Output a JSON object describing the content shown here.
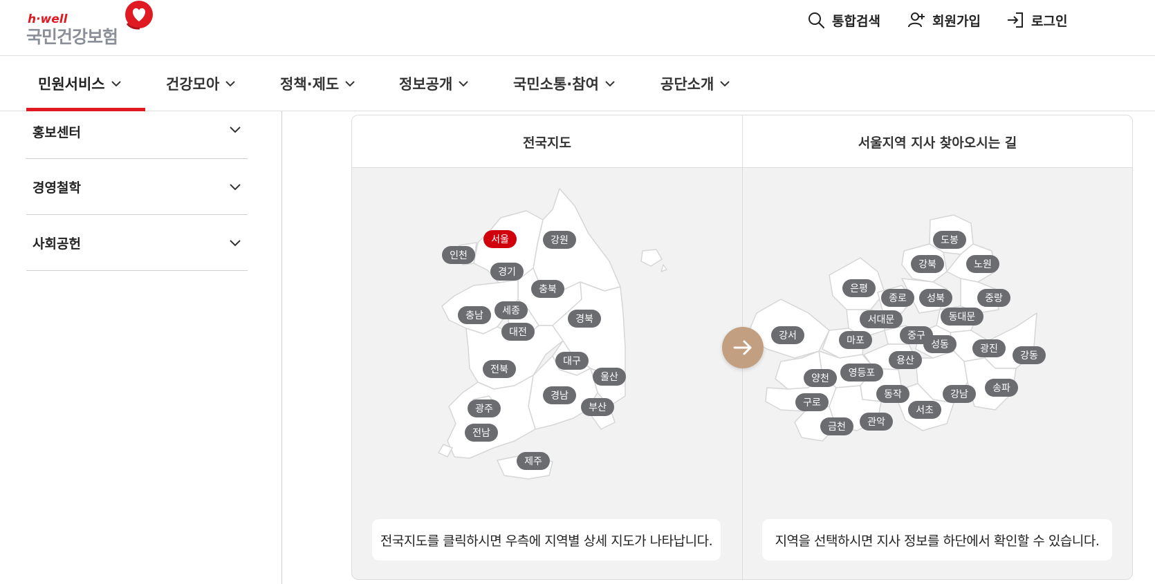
{
  "logo": {
    "sub": "h·well",
    "main": "국민건강보험"
  },
  "util": {
    "search": "통합검색",
    "join": "회원가입",
    "login": "로그인"
  },
  "gnb": [
    {
      "label": "민원서비스"
    },
    {
      "label": "건강모아"
    },
    {
      "label": "정책·제도"
    },
    {
      "label": "정보공개"
    },
    {
      "label": "국민소통·참여"
    },
    {
      "label": "공단소개"
    }
  ],
  "sidebar": [
    {
      "label": "홍보센터"
    },
    {
      "label": "경영철학"
    },
    {
      "label": "사회공헌"
    }
  ],
  "panel": {
    "left_title": "전국지도",
    "right_title": "서울지역 지사 찾아오시는 길",
    "left_caption": "전국지도를 클릭하시면 우측에 지역별 상세 지도가 나타납니다.",
    "right_caption": "지역을 선택하시면 지사 정보를 하단에서 확인할 수 있습니다."
  },
  "colors": {
    "accent": "#e01a22",
    "label": "#6b6c70",
    "selected": "#d0000c",
    "arrow": "#c29f81"
  },
  "national_regions": [
    {
      "name": "서울",
      "selected": true
    },
    {
      "name": "강원"
    },
    {
      "name": "인천"
    },
    {
      "name": "경기"
    },
    {
      "name": "충북"
    },
    {
      "name": "충남"
    },
    {
      "name": "세종"
    },
    {
      "name": "경북"
    },
    {
      "name": "대전"
    },
    {
      "name": "대구"
    },
    {
      "name": "전북"
    },
    {
      "name": "울산"
    },
    {
      "name": "경남"
    },
    {
      "name": "광주"
    },
    {
      "name": "부산"
    },
    {
      "name": "전남"
    },
    {
      "name": "제주"
    }
  ],
  "seoul_districts": [
    {
      "name": "도봉"
    },
    {
      "name": "강북"
    },
    {
      "name": "노원"
    },
    {
      "name": "은평"
    },
    {
      "name": "종로"
    },
    {
      "name": "성북"
    },
    {
      "name": "중랑"
    },
    {
      "name": "서대문"
    },
    {
      "name": "동대문"
    },
    {
      "name": "강서"
    },
    {
      "name": "중구"
    },
    {
      "name": "마포"
    },
    {
      "name": "성동"
    },
    {
      "name": "광진"
    },
    {
      "name": "강동"
    },
    {
      "name": "용산"
    },
    {
      "name": "영등포"
    },
    {
      "name": "양천"
    },
    {
      "name": "동작"
    },
    {
      "name": "강남"
    },
    {
      "name": "송파"
    },
    {
      "name": "구로"
    },
    {
      "name": "서초"
    },
    {
      "name": "관악"
    },
    {
      "name": "금천"
    }
  ]
}
